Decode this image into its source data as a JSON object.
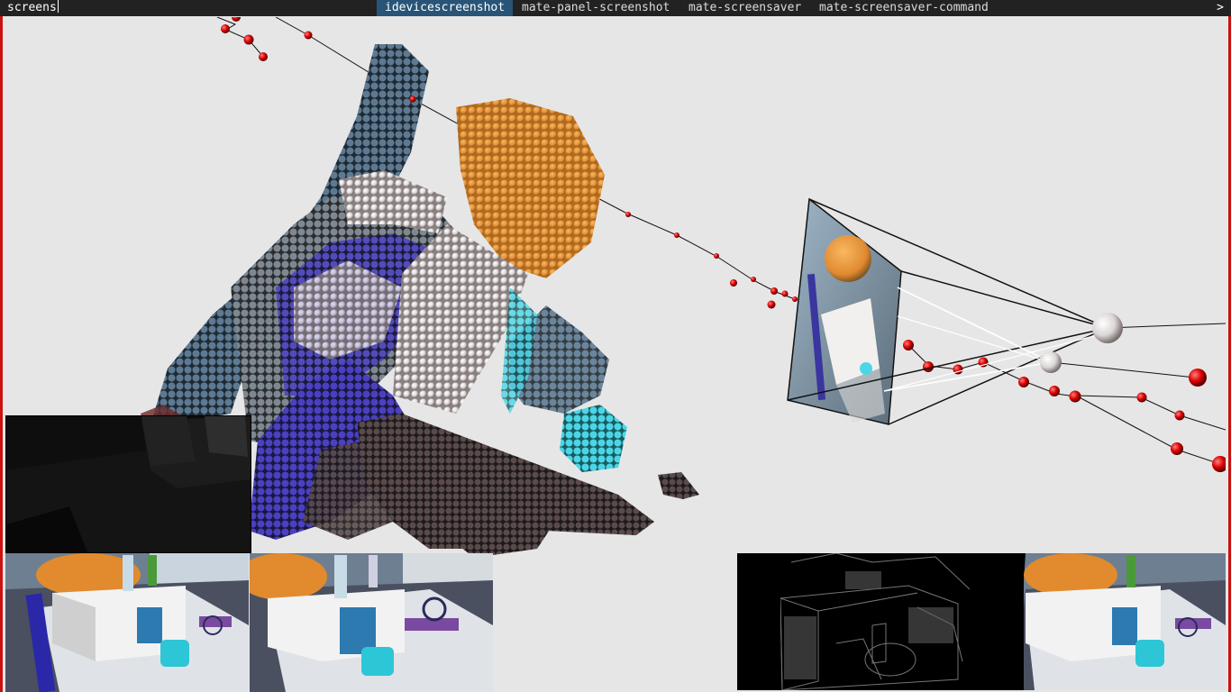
{
  "launcher": {
    "query": "screens",
    "suggestions": [
      "idevicescreenshot",
      "mate-panel-screenshot",
      "mate-screensaver",
      "mate-screensaver-command"
    ],
    "selected_index": 0,
    "more_indicator": ">"
  },
  "colors": {
    "bar_bg": "#222222",
    "selected_bg": "#285577",
    "window_border": "#cc1111",
    "viewport_bg": "#e6e6e6",
    "trajectory_node": "#dd0000"
  },
  "viewer": {
    "panels": [
      "depth-view",
      "rgb-view-left",
      "rgb-view-right",
      "gradient-view",
      "rgb-view-aligned"
    ]
  }
}
